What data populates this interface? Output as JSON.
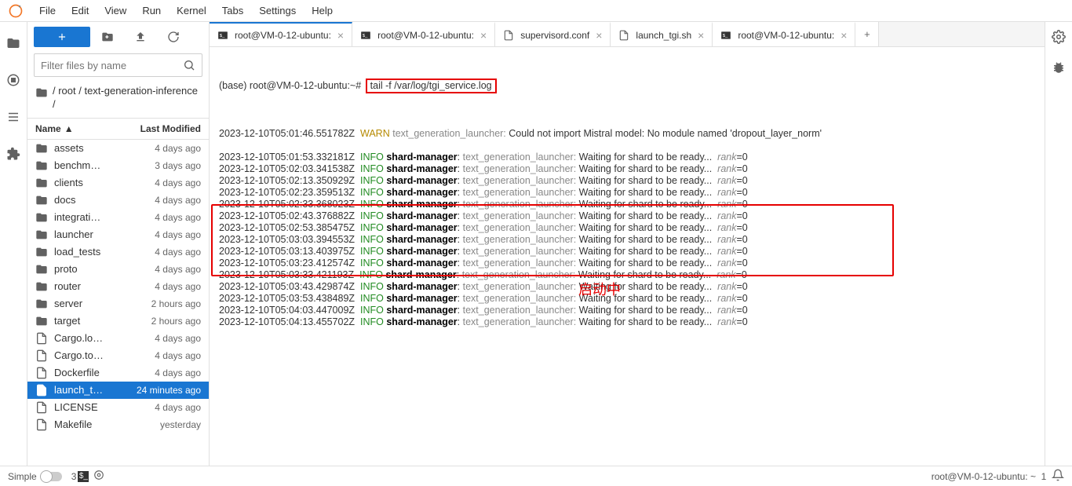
{
  "menu": [
    "File",
    "Edit",
    "View",
    "Run",
    "Kernel",
    "Tabs",
    "Settings",
    "Help"
  ],
  "filter_placeholder": "Filter files by name",
  "breadcrumb": "/ root / text-generation-inference /",
  "cols": {
    "name": "Name",
    "modified": "Last Modified"
  },
  "files": [
    {
      "t": "d",
      "n": "assets",
      "m": "4 days ago"
    },
    {
      "t": "d",
      "n": "benchm…",
      "m": "3 days ago"
    },
    {
      "t": "d",
      "n": "clients",
      "m": "4 days ago"
    },
    {
      "t": "d",
      "n": "docs",
      "m": "4 days ago"
    },
    {
      "t": "d",
      "n": "integrati…",
      "m": "4 days ago"
    },
    {
      "t": "d",
      "n": "launcher",
      "m": "4 days ago"
    },
    {
      "t": "d",
      "n": "load_tests",
      "m": "4 days ago"
    },
    {
      "t": "d",
      "n": "proto",
      "m": "4 days ago"
    },
    {
      "t": "d",
      "n": "router",
      "m": "4 days ago"
    },
    {
      "t": "d",
      "n": "server",
      "m": "2 hours ago"
    },
    {
      "t": "d",
      "n": "target",
      "m": "2 hours ago"
    },
    {
      "t": "f",
      "n": "Cargo.lo…",
      "m": "4 days ago"
    },
    {
      "t": "f",
      "n": "Cargo.to…",
      "m": "4 days ago"
    },
    {
      "t": "f",
      "n": "Dockerfile",
      "m": "4 days ago"
    },
    {
      "t": "f",
      "n": "launch_t…",
      "m": "24 minutes ago",
      "sel": true
    },
    {
      "t": "f",
      "n": "LICENSE",
      "m": "4 days ago"
    },
    {
      "t": "f",
      "n": "Makefile",
      "m": "yesterday"
    }
  ],
  "tabs": [
    {
      "icon": "term",
      "label": "root@VM-0-12-ubuntu: ",
      "active": true
    },
    {
      "icon": "term",
      "label": "root@VM-0-12-ubuntu: "
    },
    {
      "icon": "file",
      "label": "supervisord.conf"
    },
    {
      "icon": "file",
      "label": "launch_tgi.sh"
    },
    {
      "icon": "term",
      "label": "root@VM-0-12-ubuntu: "
    }
  ],
  "prompt": "(base) root@VM-0-12-ubuntu:~#",
  "command": "tail -f /var/log/tgi_service.log",
  "annotation": "启动中",
  "log": [
    {
      "ts": "2023-12-10T05:01:46.551782Z",
      "lvl": "WARN",
      "mod": "",
      "src": "text_generation_launcher:",
      "msg": "Could not import Mistral model: No module named 'dropout_layer_norm'",
      "rank": ""
    },
    {
      "blank": true
    },
    {
      "ts": "2023-12-10T05:01:53.332181Z",
      "lvl": "INFO",
      "mod": "shard-manager",
      "src": "text_generation_launcher:",
      "msg": "Waiting for shard to be ready...",
      "rank": "rank=0"
    },
    {
      "ts": "2023-12-10T05:02:03.341538Z",
      "lvl": "INFO",
      "mod": "shard-manager",
      "src": "text_generation_launcher:",
      "msg": "Waiting for shard to be ready...",
      "rank": "rank=0"
    },
    {
      "ts": "2023-12-10T05:02:13.350929Z",
      "lvl": "INFO",
      "mod": "shard-manager",
      "src": "text_generation_launcher:",
      "msg": "Waiting for shard to be ready...",
      "rank": "rank=0"
    },
    {
      "ts": "2023-12-10T05:02:23.359513Z",
      "lvl": "INFO",
      "mod": "shard-manager",
      "src": "text_generation_launcher:",
      "msg": "Waiting for shard to be ready...",
      "rank": "rank=0"
    },
    {
      "ts": "2023-12-10T05:02:33.368023Z",
      "lvl": "INFO",
      "mod": "shard-manager",
      "src": "text_generation_launcher:",
      "msg": "Waiting for shard to be ready...",
      "rank": "rank=0"
    },
    {
      "ts": "2023-12-10T05:02:43.376882Z",
      "lvl": "INFO",
      "mod": "shard-manager",
      "src": "text_generation_launcher:",
      "msg": "Waiting for shard to be ready...",
      "rank": "rank=0"
    },
    {
      "ts": "2023-12-10T05:02:53.385475Z",
      "lvl": "INFO",
      "mod": "shard-manager",
      "src": "text_generation_launcher:",
      "msg": "Waiting for shard to be ready...",
      "rank": "rank=0"
    },
    {
      "ts": "2023-12-10T05:03:03.394553Z",
      "lvl": "INFO",
      "mod": "shard-manager",
      "src": "text_generation_launcher:",
      "msg": "Waiting for shard to be ready...",
      "rank": "rank=0"
    },
    {
      "ts": "2023-12-10T05:03:13.403975Z",
      "lvl": "INFO",
      "mod": "shard-manager",
      "src": "text_generation_launcher:",
      "msg": "Waiting for shard to be ready...",
      "rank": "rank=0"
    },
    {
      "ts": "2023-12-10T05:03:23.412574Z",
      "lvl": "INFO",
      "mod": "shard-manager",
      "src": "text_generation_launcher:",
      "msg": "Waiting for shard to be ready...",
      "rank": "rank=0",
      "strike": true
    },
    {
      "ts": "2023-12-10T05:03:33.421193Z",
      "lvl": "INFO",
      "mod": "shard-manager",
      "src": "text_generation_launcher:",
      "msg": "Waiting for shard to be ready...",
      "rank": "rank=0"
    },
    {
      "ts": "2023-12-10T05:03:43.429874Z",
      "lvl": "INFO",
      "mod": "shard-manager",
      "src": "text_generation_launcher:",
      "msg": "Waiting for shard to be ready...",
      "rank": "rank=0"
    },
    {
      "ts": "2023-12-10T05:03:53.438489Z",
      "lvl": "INFO",
      "mod": "shard-manager",
      "src": "text_generation_launcher:",
      "msg": "Waiting for shard to be ready...",
      "rank": "rank=0"
    },
    {
      "ts": "2023-12-10T05:04:03.447009Z",
      "lvl": "INFO",
      "mod": "shard-manager",
      "src": "text_generation_launcher:",
      "msg": "Waiting for shard to be ready...",
      "rank": "rank=0"
    },
    {
      "ts": "2023-12-10T05:04:13.455702Z",
      "lvl": "INFO",
      "mod": "shard-manager",
      "src": "text_generation_launcher:",
      "msg": "Waiting for shard to be ready...",
      "rank": "rank=0"
    }
  ],
  "status": {
    "left": "Simple",
    "num": "3",
    "badge": "$_",
    "right": "root@VM-0-12-ubuntu: ~",
    "rnum": "1"
  }
}
